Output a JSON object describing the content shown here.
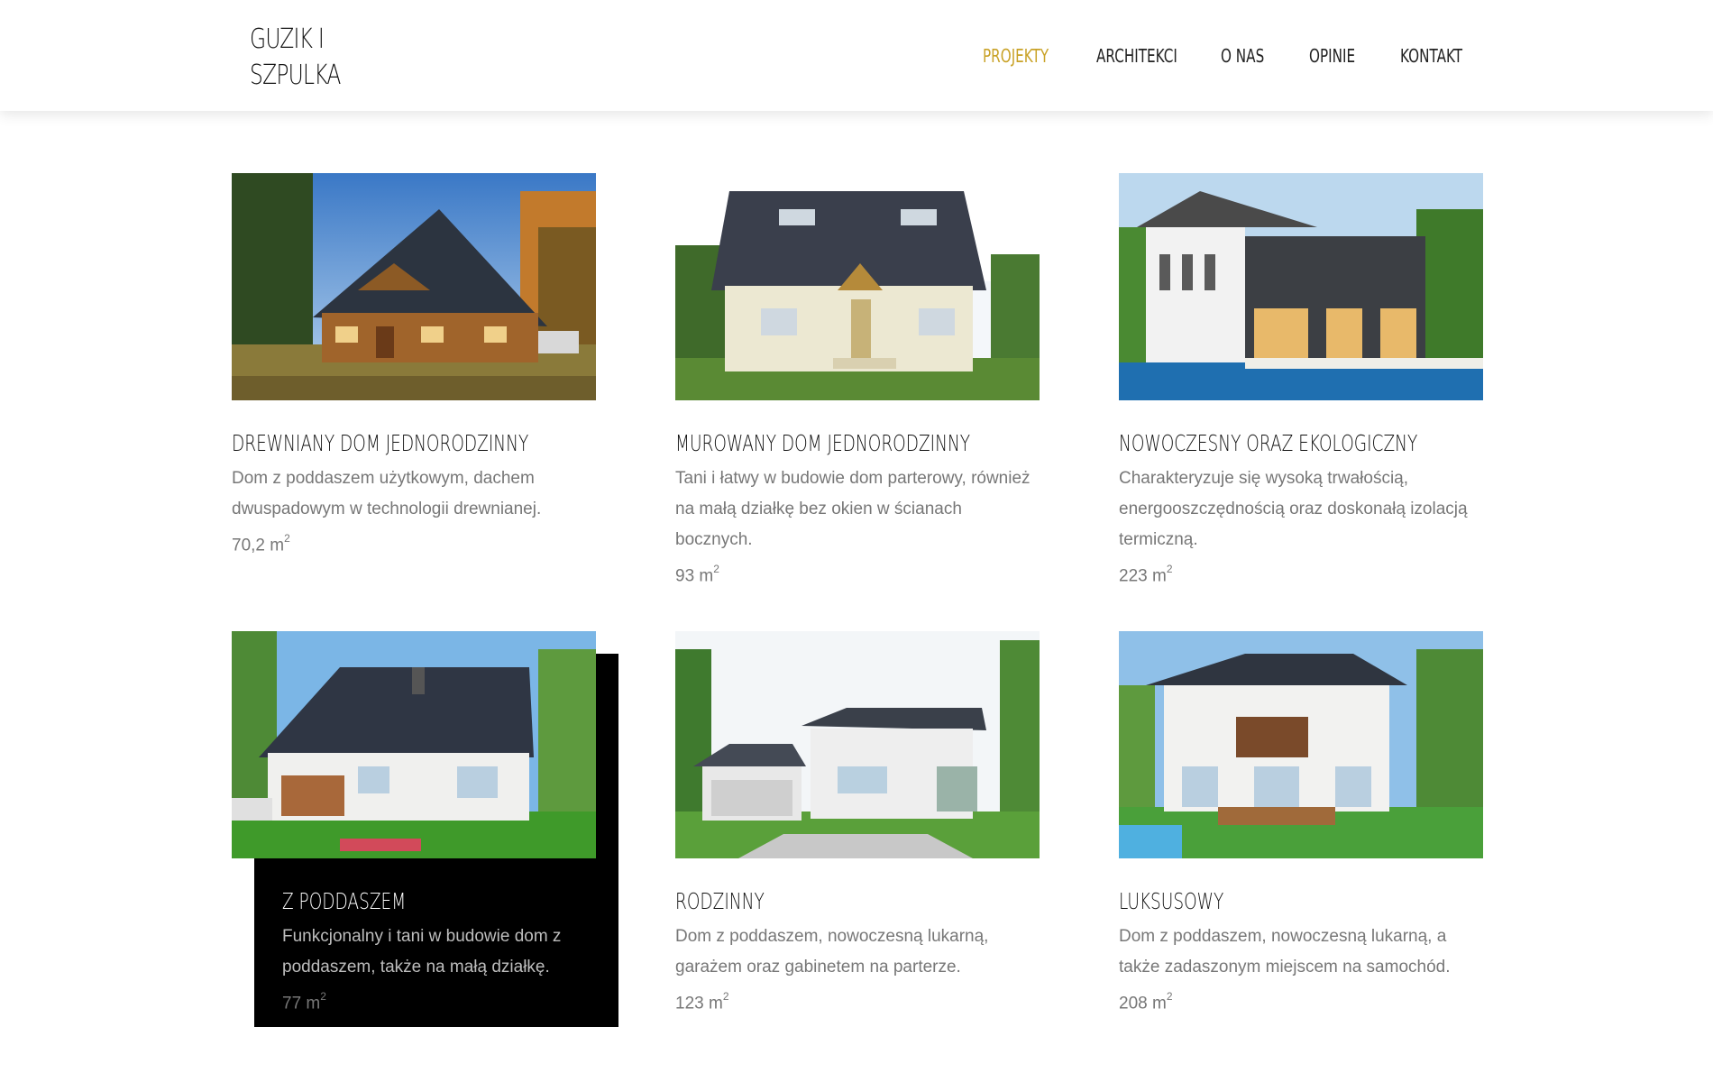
{
  "header": {
    "logo_line1": "GUZIK I",
    "logo_line2": "SZPULKA",
    "nav": [
      {
        "label": "PROJEKTY",
        "active": true
      },
      {
        "label": "ARCHITEKCI",
        "active": false
      },
      {
        "label": "O NAS",
        "active": false
      },
      {
        "label": "OPINIE",
        "active": false
      },
      {
        "label": "KONTAKT",
        "active": false
      }
    ],
    "accent_color": "#c9a227"
  },
  "projects": [
    {
      "title": "DREWNIANY DOM JEDNORODZINNY",
      "description": "Dom z poddaszem użytkowym, dachem dwuspadowym w technologii drewnianej.",
      "area": "70,2 m",
      "area_sup": "2",
      "image": "wooden-house-photo"
    },
    {
      "title": "MUROWANY DOM JEDNORODZINNY",
      "description": "Tani i łatwy w budowie dom parterowy, również na małą działkę bez okien w ścianach bocznych.",
      "area": "93 m",
      "area_sup": "2",
      "image": "brick-house-photo"
    },
    {
      "title": "NOWOCZESNY ORAZ EKOLOGICZNY",
      "description": "Charakteryzuje się wysoką trwałością, energooszczędnością oraz doskonałą izolacją termiczną.",
      "area": "223 m",
      "area_sup": "2",
      "image": "modern-house-photo"
    },
    {
      "title": "Z PODDASZEM",
      "description": "Funkcjonalny i tani w budowie dom z poddaszem, także na małą działkę.",
      "area": "77 m",
      "area_sup": "2",
      "image": "attic-house-photo",
      "featured": true
    },
    {
      "title": "RODZINNY",
      "description": "Dom z poddaszem, nowoczesną lukarną, garażem oraz gabinetem na parterze.",
      "area": "123 m",
      "area_sup": "2",
      "image": "family-house-photo"
    },
    {
      "title": "LUKSUSOWY",
      "description": "Dom z poddaszem, nowoczesną lukarną, a także zadaszonym miejscem na samochód.",
      "area": "208 m",
      "area_sup": "2",
      "image": "luxury-house-photo"
    }
  ]
}
